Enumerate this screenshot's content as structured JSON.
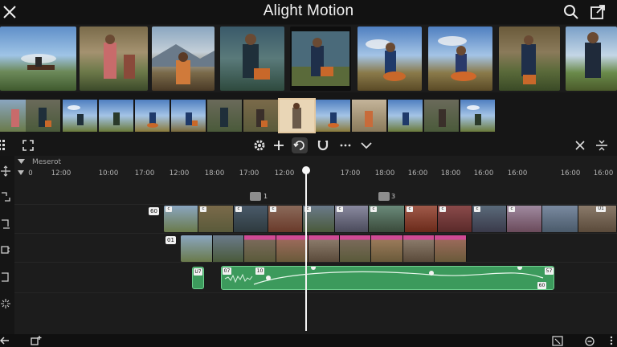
{
  "app": {
    "title": "Alight Motion"
  },
  "icons": {
    "close": "close-icon",
    "search": "search-icon",
    "export": "share-icon",
    "grid": "grid-icon",
    "crop": "crop-icon",
    "gear": "gear-icon",
    "add": "plus-icon",
    "loop": "loop-icon",
    "magnet": "magnet-icon",
    "more": "more-icon",
    "chevron": "chevron-down-icon",
    "collapse": "close-icon",
    "split": "split-icon"
  },
  "colors": {
    "accent_green": "#3c9a5c",
    "clip_pink": "#d04a95",
    "selected_outline": "#e3c8a0",
    "playhead": "#f4f4f4"
  },
  "timeline": {
    "label": "Meserot",
    "ruler_ticks": [
      "0",
      "12:00",
      "10:00",
      "17:00",
      "12:00",
      "18:00",
      "17:00",
      "12:00",
      "17:00",
      "18:00",
      "16:00",
      "18:00",
      "16:00",
      "16:00",
      "16:00",
      "16:00"
    ],
    "markers": [
      "1",
      "3"
    ],
    "track_badges": [
      "60",
      "01"
    ],
    "video_clip_badges": [
      "c",
      "c",
      "c",
      "c",
      "c",
      "c",
      "c",
      "c",
      "c",
      "c",
      "c",
      "U1"
    ],
    "audio_badges": {
      "clip_a": "U7",
      "clip_b_start": "07",
      "clip_b_inner": "10",
      "clip_b_end": "57",
      "clip_b_end_bottom": "60"
    }
  }
}
